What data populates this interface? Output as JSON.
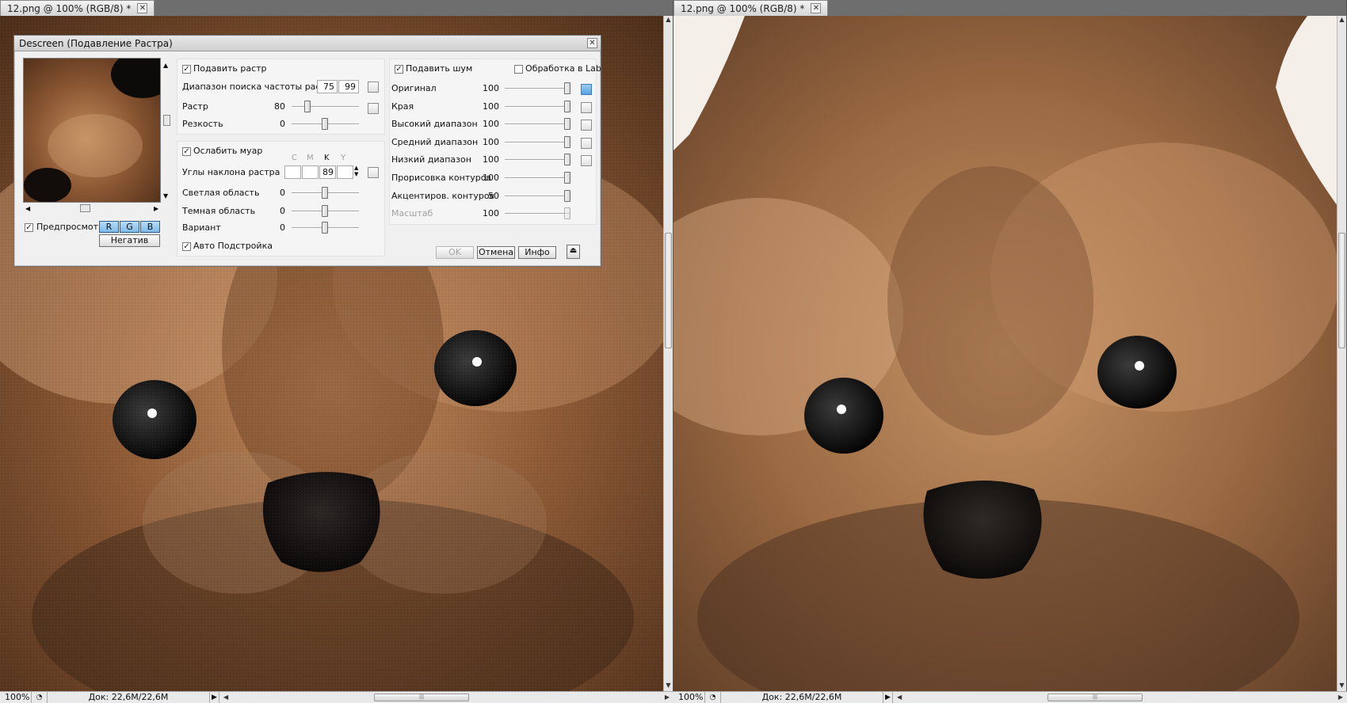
{
  "documents": [
    {
      "tab_title": "12.png @ 100% (RGB/8) *",
      "zoom": "100%",
      "doc_info": "Док: 22,6M/22,6M"
    },
    {
      "tab_title": "12.png @ 100% (RGB/8) *",
      "zoom": "100%",
      "doc_info": "Док: 22,6M/22,6M"
    }
  ],
  "icons": {
    "close": "close-icon",
    "scroll_arrow": "arrow-icon",
    "grip": "grip-icon"
  },
  "dialog": {
    "title": "Descreen (Подавление Растра)",
    "preview": {
      "label": "Предпросмотр",
      "checked": true,
      "r": "R",
      "g": "G",
      "b": "B",
      "negative": "Негатив"
    },
    "raster": {
      "enabled_label": "Подавить растр",
      "search_range_label": "Диапазон поиска частоты растра",
      "search_min": "75",
      "search_max": "99",
      "raster_label": "Растр",
      "raster_value": "80",
      "sharpness_label": "Резкость",
      "sharpness_value": "0"
    },
    "moire": {
      "enabled_label": "Ослабить муар",
      "channels": [
        "C",
        "M",
        "K",
        "Y"
      ],
      "angles_label": "Углы наклона растра",
      "k_angle": "89",
      "light_label": "Светлая область",
      "light_value": "0",
      "dark_label": "Темная область",
      "dark_value": "0",
      "variant_label": "Вариант",
      "variant_value": "0",
      "auto_label": "Авто Подстройка"
    },
    "noise": {
      "enabled_label": "Подавить шум",
      "lab_label": "Обработка в Lab",
      "rows": [
        {
          "label": "Оригинал",
          "value": "100"
        },
        {
          "label": "Края",
          "value": "100"
        },
        {
          "label": "Высокий диапазон",
          "value": "100"
        },
        {
          "label": "Средний диапазон",
          "value": "100"
        },
        {
          "label": "Низкий диапазон",
          "value": "100"
        },
        {
          "label": "Прорисовка контуров",
          "value": "100"
        },
        {
          "label": "Акцентиров. контуров",
          "value": "50"
        },
        {
          "label": "Масштаб",
          "value": "100"
        }
      ]
    },
    "buttons": {
      "ok": "OK",
      "cancel": "Отмена",
      "info": "Инфо"
    }
  }
}
